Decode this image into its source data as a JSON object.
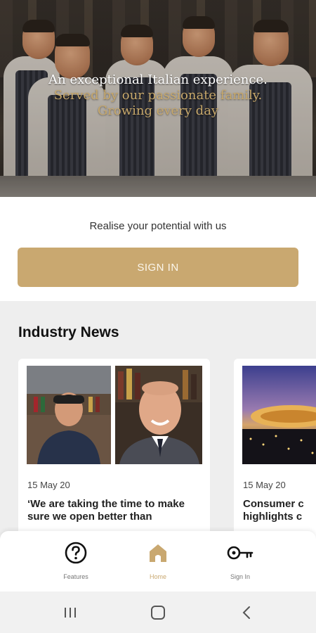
{
  "hero": {
    "line1": "An exceptional Italian experience.",
    "line2": "Served by our passionate family.",
    "line3": "Growing every day"
  },
  "signin": {
    "tagline": "Realise your potential with us",
    "button_label": "SIGN IN"
  },
  "news": {
    "heading": "Industry News",
    "cards": [
      {
        "date": "15 May 20",
        "title": "‘We are taking the time to make sure we open better than"
      },
      {
        "date": "15 May 20",
        "title": "Consumer c highlights c"
      }
    ]
  },
  "bottom_nav": {
    "items": [
      {
        "label": "Features",
        "icon": "question-circle-icon"
      },
      {
        "label": "Home",
        "icon": "home-icon",
        "active": true
      },
      {
        "label": "Sign In",
        "icon": "key-icon"
      }
    ]
  },
  "colors": {
    "accent": "#c9a870",
    "hero_secondary_text": "#c7a86b",
    "news_background": "#eeeeee"
  }
}
